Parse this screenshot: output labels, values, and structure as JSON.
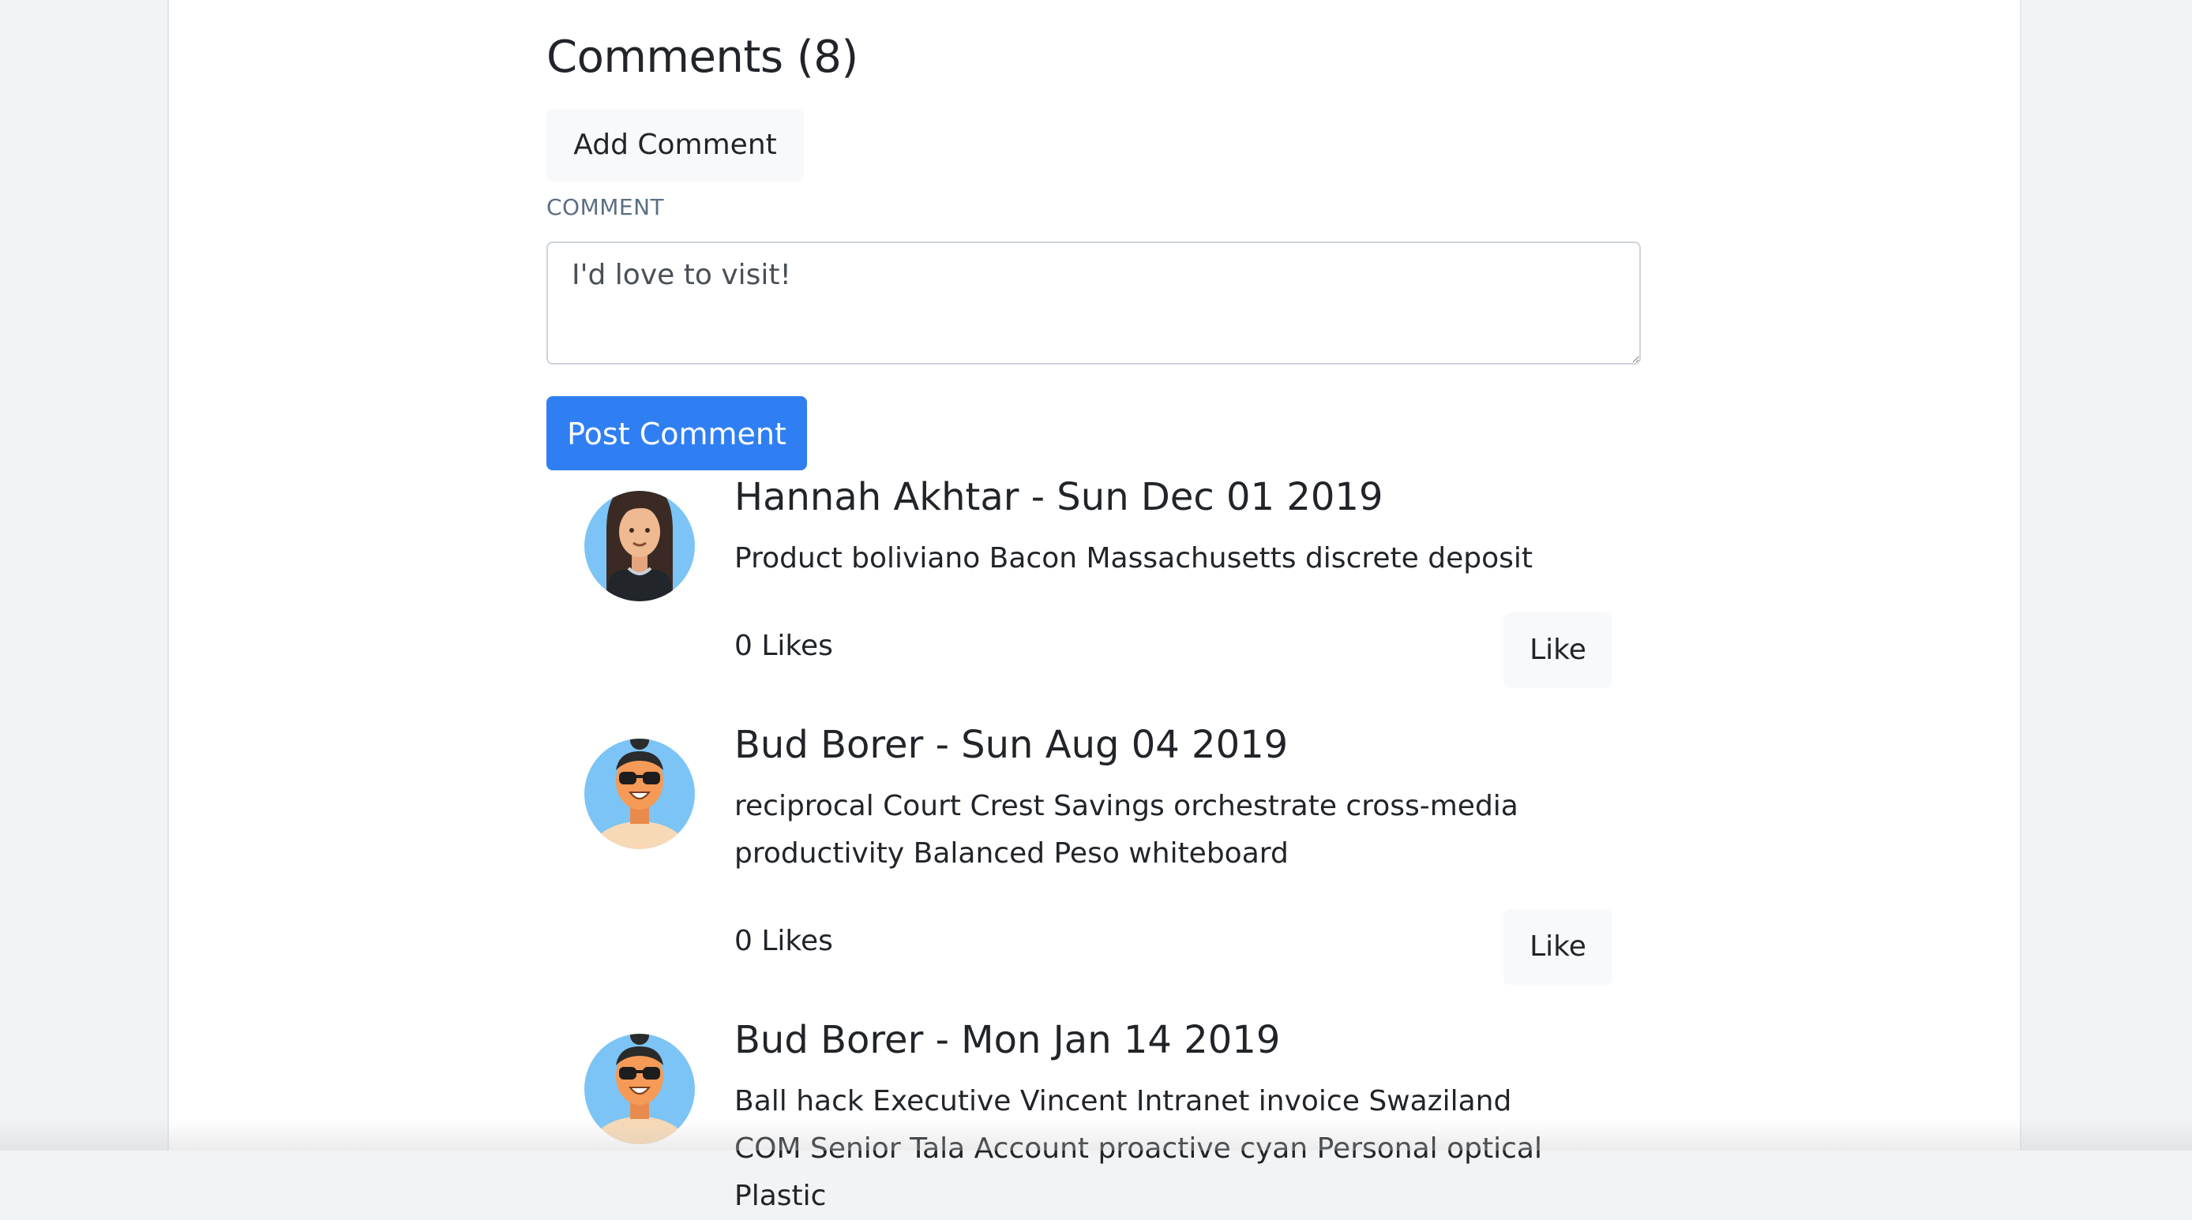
{
  "comments_section": {
    "title": "Comments (8)",
    "add_comment_label": "Add Comment",
    "field_label": "COMMENT",
    "textarea_value": "I'd love to visit!",
    "post_label": "Post Comment"
  },
  "comments": [
    {
      "header": "Hannah Akhtar - Sun Dec 01 2019",
      "body": "Product boliviano Bacon Massachusetts discrete deposit",
      "likes": "0 Likes",
      "like_label": "Like"
    },
    {
      "header": "Bud Borer - Sun Aug 04 2019",
      "body": "reciprocal Court Crest Savings orchestrate cross-media productivity Balanced Peso whiteboard",
      "likes": "0 Likes",
      "like_label": "Like"
    },
    {
      "header": "Bud Borer - Mon Jan 14 2019",
      "body": "Ball hack Executive Vincent Intranet invoice Swaziland COM Senior Tala Account proactive cyan Personal optical Plastic",
      "likes": "",
      "like_label": ""
    }
  ],
  "colors": {
    "primary": "#2f7ff3",
    "light_button": "#f8f9fa",
    "avatar_bg": "#7cc4f5",
    "page_bg": "#f1f3f5"
  },
  "icons": {
    "avatar_1": "woman-avatar-icon",
    "avatar_2": "man-sunglasses-avatar-icon",
    "avatar_3": "man-sunglasses-avatar-icon"
  }
}
